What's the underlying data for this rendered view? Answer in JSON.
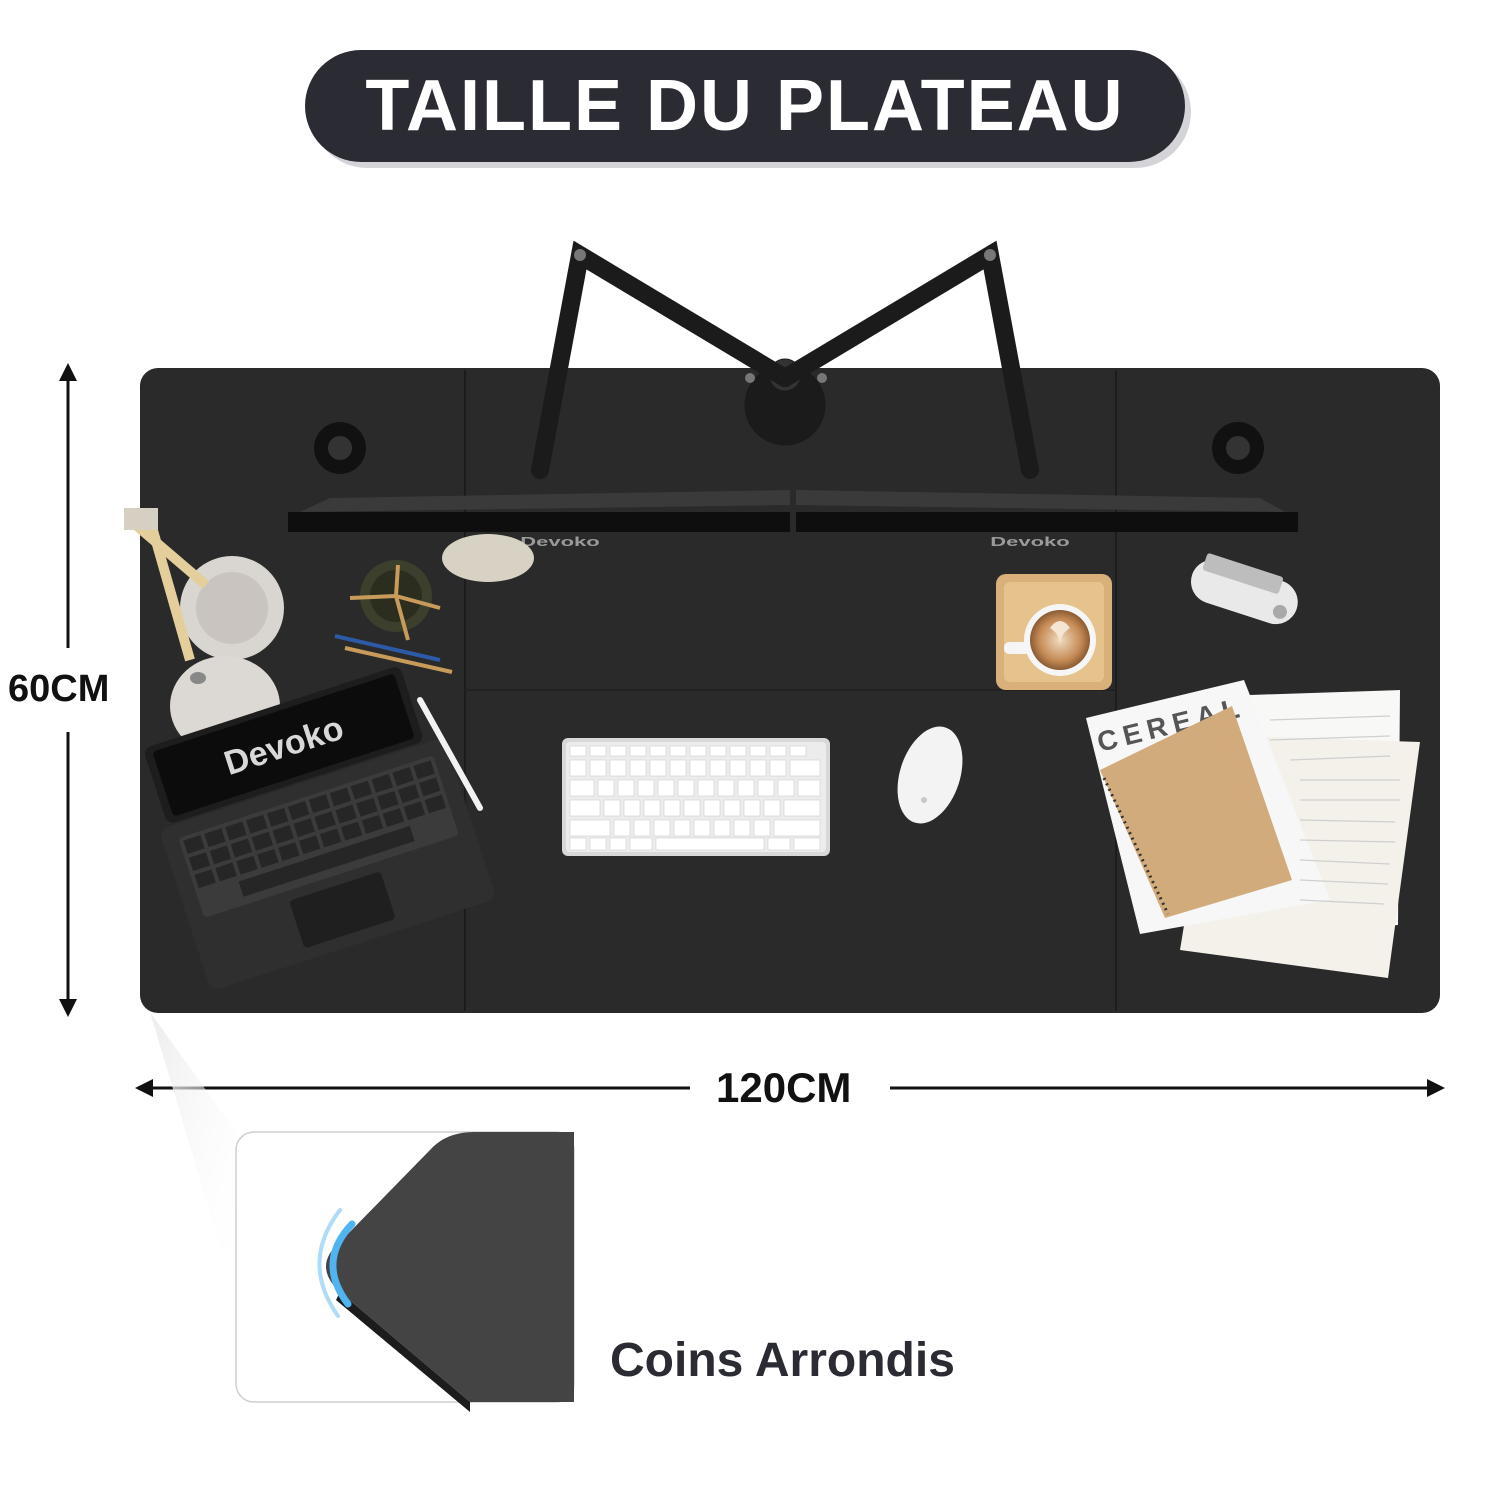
{
  "header": {
    "title": "TAILLE DU PLATEAU"
  },
  "dimensions": {
    "height": "60CM",
    "width": "120CM"
  },
  "corner_detail": {
    "label": "Coins Arrondis"
  },
  "brand": {
    "tablet_logo": "Devoko",
    "monitor_logo_left": "Devoko",
    "monitor_logo_right": "Devoko",
    "magazine_title": "CEREAL"
  },
  "colors": {
    "desk": "#2a2a2a",
    "title_pill": "#2b2b33",
    "text": "#111111",
    "corner_glow": "#4fb4ef",
    "kraft": "#d2ab7c"
  }
}
